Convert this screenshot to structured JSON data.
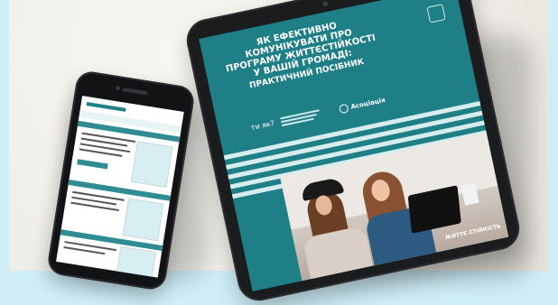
{
  "tablet": {
    "title": "Як ефективно комунікувати про програму життєстійкості у вашій громаді:",
    "subtitle": "Практичний посібник",
    "logo_a": "ти як?",
    "logo_c": "Асоціація",
    "brand": "ЖИТТЄ СТІЙКІСТЬ"
  },
  "colors": {
    "tablet_screen": "#1f7f86",
    "stripe": "#d7ecec",
    "background": "#f1efea"
  }
}
